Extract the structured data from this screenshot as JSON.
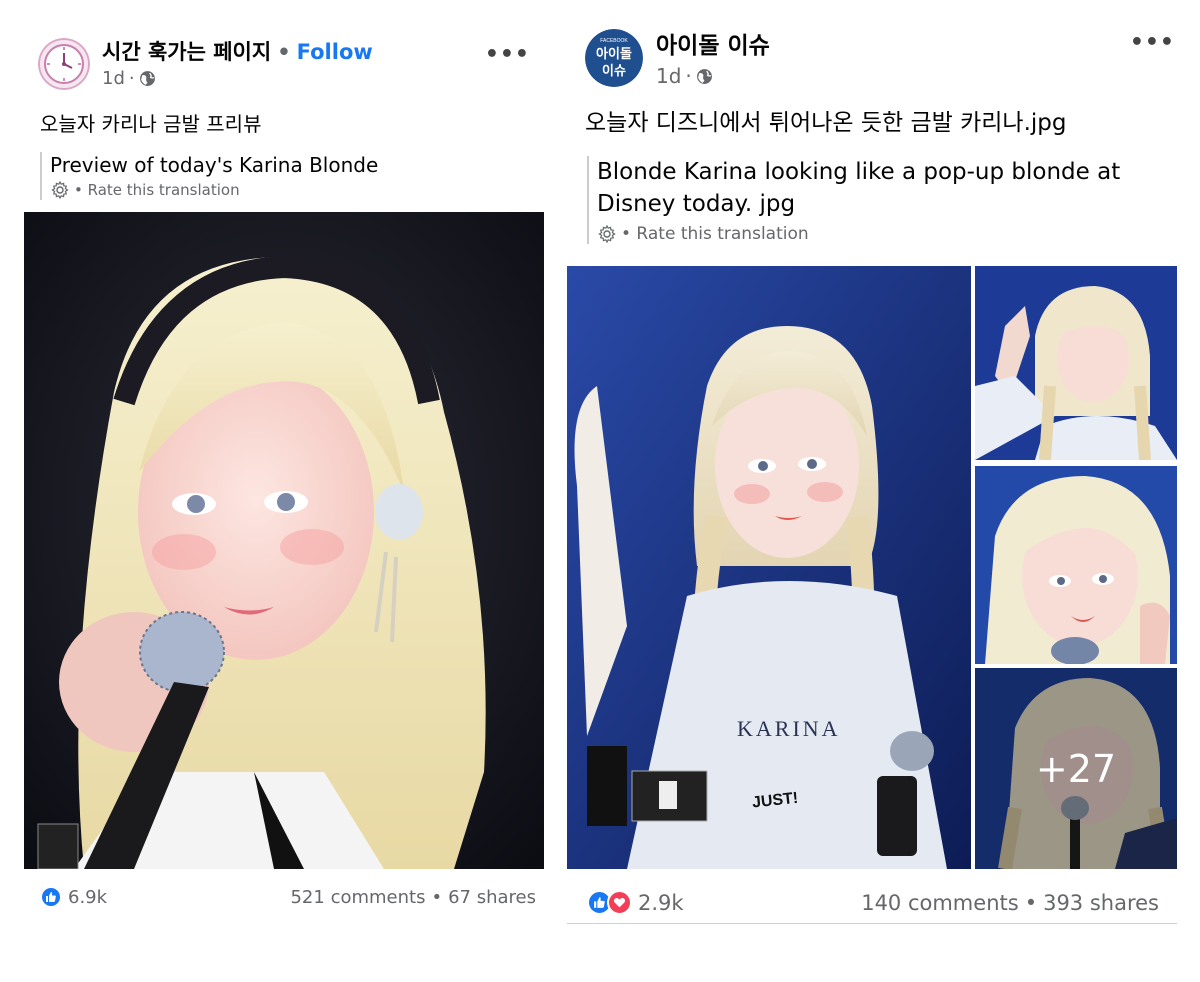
{
  "posts": [
    {
      "page_name": "시간 훅가는 페이지",
      "follow_label": "Follow",
      "separator": "•",
      "time": "1d",
      "time_sep": "·",
      "text": "오늘자 카리나 금발 프리뷰",
      "translation": "Preview of today's Karina Blonde",
      "rate_label": "• Rate this translation",
      "more": "•••",
      "reaction_count": "6.9k",
      "comments": "521 comments",
      "shares": "67 shares",
      "counts_sep": "•"
    },
    {
      "page_name": "아이돌 이슈",
      "avatar_text_small": "FACEBOOK",
      "avatar_text_1": "아이돌",
      "avatar_text_2": "이슈",
      "time": "1d",
      "time_sep": "·",
      "text": "오늘자 디즈니에서 튀어나온 듯한 금발 카리나.jpg",
      "translation": "Blonde Karina looking like a pop-up blonde at Disney today. jpg",
      "rate_label": "• Rate this translation",
      "more": "•••",
      "reaction_count": "2.9k",
      "comments": "140 comments",
      "shares": "393 shares",
      "counts_sep": "•",
      "more_photos": "+27",
      "photo_text_1": "KARINA",
      "photo_text_2": "JUST!"
    }
  ],
  "colors": {
    "accent": "#1877f2",
    "secondary_text": "#65676b",
    "like": "#1877f2",
    "love": "#f33e58",
    "avatar2_bg": "#1f4f8f"
  },
  "icons": [
    "clock-icon",
    "globe-icon",
    "more-icon",
    "gear-icon",
    "like-icon",
    "love-icon"
  ]
}
